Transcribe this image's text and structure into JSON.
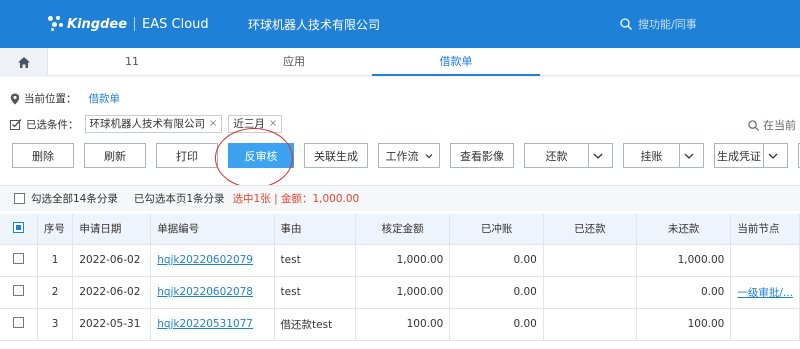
{
  "header": {
    "brand": "Kingdee",
    "product": "EAS Cloud",
    "company": "环球机器人技术有限公司",
    "search_placeholder": "搜功能/同事"
  },
  "tabs": {
    "tab1": "11",
    "tab2": "应用",
    "tab3": "借款单"
  },
  "location": {
    "label": "当前位置：",
    "value": "借款单"
  },
  "filters": {
    "label": "已选条件：",
    "chips": [
      "环球机器人技术有限公司",
      "近三月"
    ],
    "chip_close": "×",
    "search_placeholder": "在当前"
  },
  "toolbar": {
    "delete": "删除",
    "refresh": "刷新",
    "print": "打印",
    "unapprove": "反审核",
    "link_generate": "关联生成",
    "workflow": "工作流",
    "view_image": "查看影像",
    "repay": "还款",
    "hang_account": "挂账",
    "gen_voucher": "生成凭证",
    "more": "生"
  },
  "selection": {
    "select_all": "勾选全部14条分录",
    "selected_page": "已勾选本页1条分录",
    "summary": "选中1张 | 金额：1,000.00"
  },
  "colors": {
    "accent": "#1f80d8",
    "primary_button": "#3da3f0",
    "highlight_red": "#d9302a"
  },
  "table": {
    "headers": [
      "序号",
      "申请日期",
      "单据编号",
      "事由",
      "核定金额",
      "已冲账",
      "已还款",
      "未还款",
      "当前节点"
    ],
    "rows": [
      {
        "no": "1",
        "date": "2022-06-02",
        "code": "hqjk20220602079",
        "reason": "test",
        "approved": "1,000.00",
        "offset": "0.00",
        "repaid": "",
        "unpaid": "1,000.00",
        "node": ""
      },
      {
        "no": "2",
        "date": "2022-06-02",
        "code": "hqjk20220602078",
        "reason": "test",
        "approved": "1,000.00",
        "offset": "0.00",
        "repaid": "",
        "unpaid": "0.00",
        "node": "一级审批/..."
      },
      {
        "no": "3",
        "date": "2022-05-31",
        "code": "hqjk20220531077",
        "reason": "借还款test",
        "approved": "100.00",
        "offset": "0.00",
        "repaid": "",
        "unpaid": "100.00",
        "node": ""
      }
    ]
  }
}
